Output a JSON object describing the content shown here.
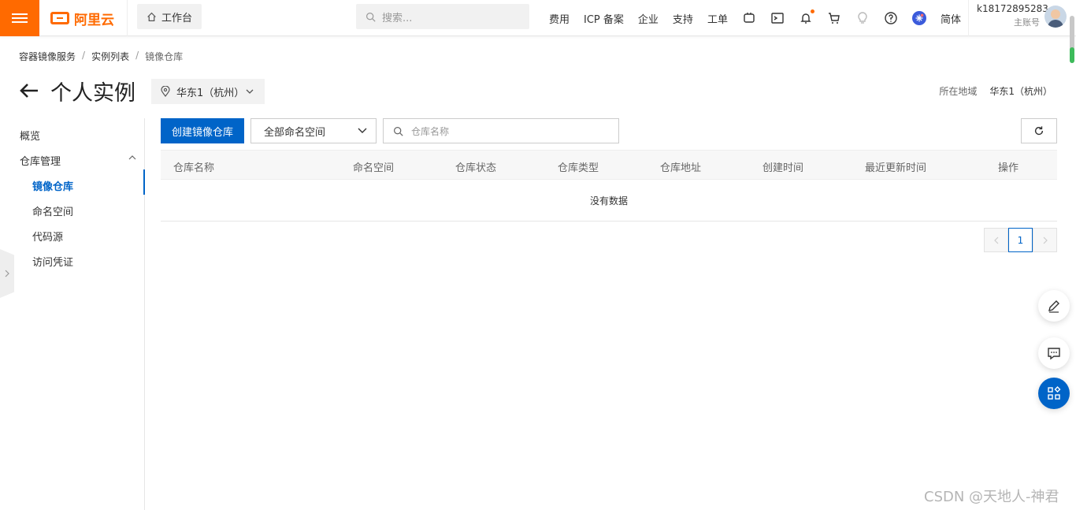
{
  "topbar": {
    "brand": "阿里云",
    "workbench": "工作台",
    "search_placeholder": "搜索...",
    "nav_items": [
      "费用",
      "ICP 备案",
      "企业",
      "支持",
      "工单"
    ],
    "lang": "简体",
    "user_id": "k18172895283",
    "user_role": "主账号"
  },
  "breadcrumb": {
    "items": [
      "容器镜像服务",
      "实例列表",
      "镜像仓库"
    ]
  },
  "page": {
    "title": "个人实例",
    "region_select": "华东1（杭州）",
    "region_label": "所在地域",
    "region_value": "华东1（杭州）"
  },
  "sidebar": {
    "overview": "概览",
    "repo_mgmt": "仓库管理",
    "items": [
      "镜像仓库",
      "命名空间",
      "代码源",
      "访问凭证"
    ]
  },
  "toolbar": {
    "create_button": "创建镜像仓库",
    "namespace_select": "全部命名空间",
    "search_placeholder": "仓库名称"
  },
  "table": {
    "columns": [
      "仓库名称",
      "命名空间",
      "仓库状态",
      "仓库类型",
      "仓库地址",
      "创建时间",
      "最近更新时间",
      "操作"
    ],
    "empty_text": "没有数据"
  },
  "pagination": {
    "current_page": "1"
  },
  "watermark": "CSDN @天地人-神君",
  "colors": {
    "brand_orange": "#ff6a00",
    "primary_blue": "#0064c8"
  }
}
